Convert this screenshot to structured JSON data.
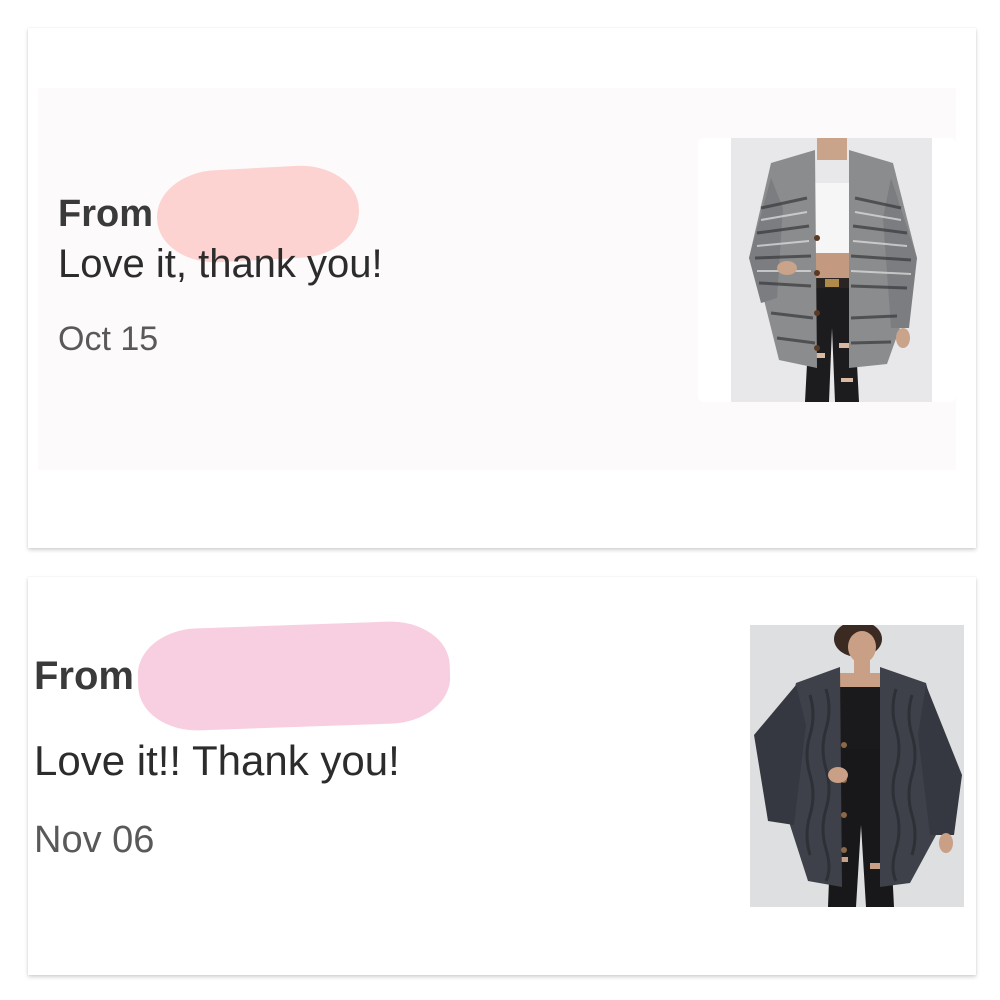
{
  "reviews": [
    {
      "from_label": "From",
      "message": "Love it, thank you!",
      "date": "Oct 15",
      "product_image": "grey-chunky-knit-cardigan",
      "redaction_color": "#fcd3d0"
    },
    {
      "from_label": "From",
      "message": "Love it!! Thank you!",
      "date": "Nov 06",
      "product_image": "charcoal-cable-knit-cardigan",
      "redaction_color": "#f8cfe0"
    }
  ]
}
